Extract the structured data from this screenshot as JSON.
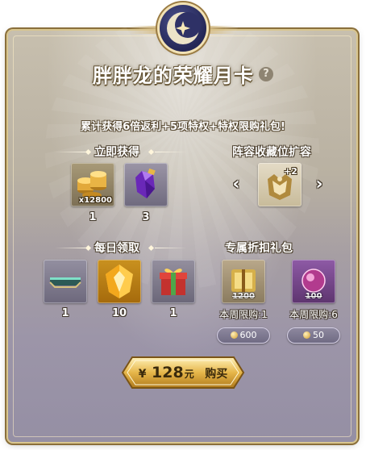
{
  "header": {
    "title": "胖胖龙的荣耀月卡",
    "help_icon": "?"
  },
  "subtitle": "累计获得6倍返利+5项特权+特权限购礼包!",
  "instant": {
    "label": "立即获得",
    "items": [
      {
        "icon": "gold-coins-icon",
        "badge": "x12800",
        "count": "1"
      },
      {
        "icon": "purple-crystal-icon",
        "count": "3"
      }
    ]
  },
  "collection": {
    "label": "阵容收藏位扩容",
    "icon": "crest-plus-icon",
    "badge": "+2"
  },
  "daily": {
    "label": "每日领取",
    "items": [
      {
        "icon": "frame-ornament-icon",
        "count": "1"
      },
      {
        "icon": "gold-shard-icon",
        "count": "10"
      },
      {
        "icon": "gift-box-icon",
        "count": "1"
      }
    ]
  },
  "discount": {
    "label": "专属折扣礼包",
    "packs": [
      {
        "icon": "golden-box-icon",
        "original": "1200",
        "limit": "本周限购:1",
        "price": "600"
      },
      {
        "icon": "magic-orb-icon",
        "original": "100",
        "limit": "本周限购:6",
        "price": "50"
      }
    ]
  },
  "purchase": {
    "currency": "¥",
    "amount": "128",
    "unit": "元",
    "action": "购买"
  },
  "colors": {
    "frame_gold": "#d9c68f",
    "emblem_navy": "#242756",
    "button_gold": "#e6b64a"
  }
}
